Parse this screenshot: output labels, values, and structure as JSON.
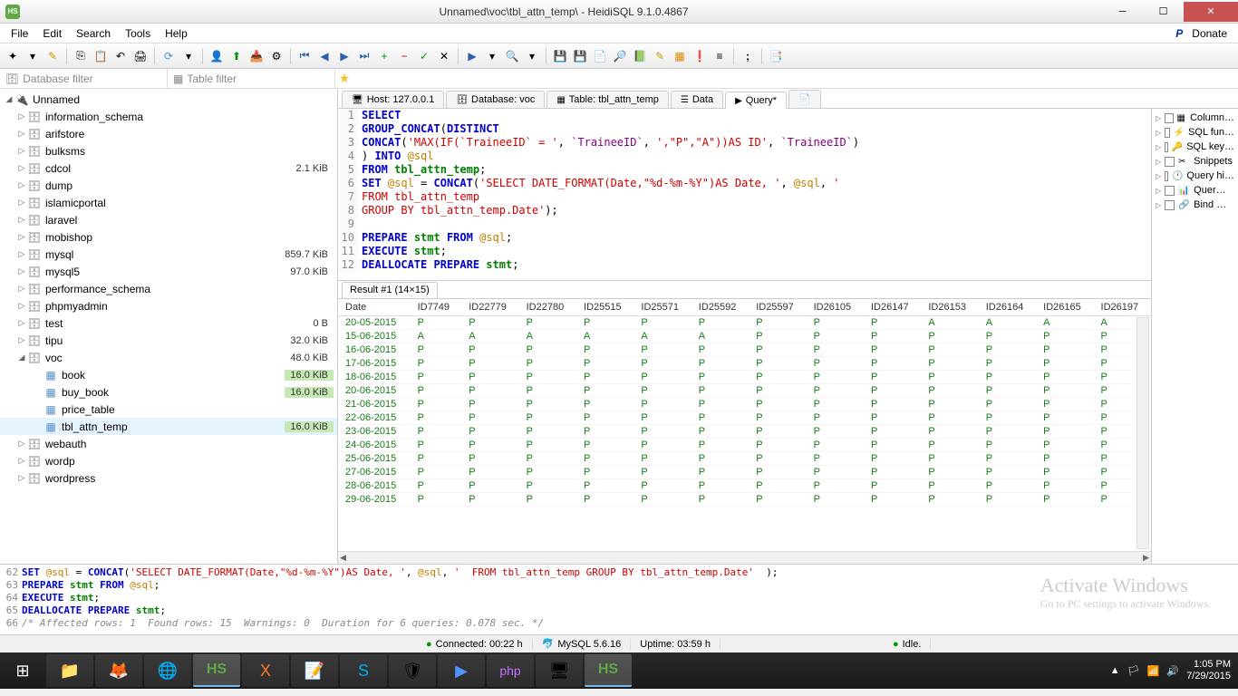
{
  "titlebar": {
    "appIcon": "HS",
    "title": "Unnamed\\voc\\tbl_attn_temp\\ - HeidiSQL 9.1.0.4867"
  },
  "menu": {
    "items": [
      "File",
      "Edit",
      "Search",
      "Tools",
      "Help"
    ],
    "donate": "Donate"
  },
  "filters": {
    "database": "Database filter",
    "table": "Table filter"
  },
  "tree": {
    "root": "Unnamed",
    "items": [
      {
        "label": "information_schema",
        "size": "",
        "indent": 1,
        "icon": "db"
      },
      {
        "label": "arifstore",
        "size": "",
        "indent": 1,
        "icon": "db"
      },
      {
        "label": "bulksms",
        "size": "",
        "indent": 1,
        "icon": "db"
      },
      {
        "label": "cdcol",
        "size": "2.1 KiB",
        "indent": 1,
        "icon": "db"
      },
      {
        "label": "dump",
        "size": "",
        "indent": 1,
        "icon": "db"
      },
      {
        "label": "islamicportal",
        "size": "",
        "indent": 1,
        "icon": "db"
      },
      {
        "label": "laravel",
        "size": "",
        "indent": 1,
        "icon": "db"
      },
      {
        "label": "mobishop",
        "size": "",
        "indent": 1,
        "icon": "db"
      },
      {
        "label": "mysql",
        "size": "859.7 KiB",
        "indent": 1,
        "icon": "db"
      },
      {
        "label": "mysql5",
        "size": "97.0 KiB",
        "indent": 1,
        "icon": "db"
      },
      {
        "label": "performance_schema",
        "size": "",
        "indent": 1,
        "icon": "db"
      },
      {
        "label": "phpmyadmin",
        "size": "",
        "indent": 1,
        "icon": "db"
      },
      {
        "label": "test",
        "size": "0 B",
        "indent": 1,
        "icon": "db"
      },
      {
        "label": "tipu",
        "size": "32.0 KiB",
        "indent": 1,
        "icon": "db"
      },
      {
        "label": "voc",
        "size": "48.0 KiB",
        "indent": 1,
        "icon": "db",
        "expanded": true
      },
      {
        "label": "book",
        "size": "16.0 KiB",
        "indent": 2,
        "icon": "tbl",
        "hl": true
      },
      {
        "label": "buy_book",
        "size": "16.0 KiB",
        "indent": 2,
        "icon": "tbl",
        "hl": true
      },
      {
        "label": "price_table",
        "size": "",
        "indent": 2,
        "icon": "tbl"
      },
      {
        "label": "tbl_attn_temp",
        "size": "16.0 KiB",
        "indent": 2,
        "icon": "tbl",
        "hl": true,
        "selected": true
      },
      {
        "label": "webauth",
        "size": "",
        "indent": 1,
        "icon": "db"
      },
      {
        "label": "wordp",
        "size": "",
        "indent": 1,
        "icon": "db"
      },
      {
        "label": "wordpress",
        "size": "",
        "indent": 1,
        "icon": "db"
      }
    ]
  },
  "tabs": {
    "items": [
      {
        "label": "Host: 127.0.0.1",
        "icon": "🖥"
      },
      {
        "label": "Database: voc",
        "icon": "🗄"
      },
      {
        "label": "Table: tbl_attn_temp",
        "icon": "▦"
      },
      {
        "label": "Data",
        "icon": "☰"
      },
      {
        "label": "Query*",
        "icon": "▶",
        "active": true
      }
    ]
  },
  "editor": {
    "lines": [
      {
        "n": "1",
        "html": "<span class='kw'>SELECT</span>"
      },
      {
        "n": "2",
        "html": "<span class='kw'>GROUP_CONCAT</span>(<span class='kw'>DISTINCT</span>"
      },
      {
        "n": "3",
        "html": "<span class='kw'>CONCAT</span>(<span class='str'>'MAX(IF(`TraineeID` = '</span>, <span class='id'>`TraineeID`</span>, <span class='str'>',\"P\",\"A\"))AS ID'</span>, <span class='id'>`TraineeID`</span>)"
      },
      {
        "n": "4",
        "html": ") <span class='kw'>INTO</span> <span class='var'>@sql</span>"
      },
      {
        "n": "5",
        "html": "<span class='kw'>FROM</span> <span class='kw2'>tbl_attn_temp</span>;"
      },
      {
        "n": "6",
        "html": "<span class='kw'>SET</span> <span class='var'>@sql</span> = <span class='kw'>CONCAT</span>(<span class='str'>'SELECT DATE_FORMAT(Date,\"%d-%m-%Y\")AS Date, '</span>, <span class='var'>@sql</span>, <span class='str'>'</span>"
      },
      {
        "n": "7",
        "html": "<span class='str'>FROM tbl_attn_temp</span>"
      },
      {
        "n": "8",
        "html": "<span class='str'>GROUP BY tbl_attn_temp.Date'</span>);"
      },
      {
        "n": "9",
        "html": ""
      },
      {
        "n": "10",
        "html": "<span class='kw'>PREPARE</span> <span class='kw2'>stmt</span> <span class='kw'>FROM</span> <span class='var'>@sql</span>;"
      },
      {
        "n": "11",
        "html": "<span class='kw'>EXECUTE</span> <span class='kw2'>stmt</span>;"
      },
      {
        "n": "12",
        "html": "<span class='kw'>DEALLOCATE</span> <span class='kw'>PREPARE</span> <span class='kw2'>stmt</span>;"
      }
    ]
  },
  "sidePanel": {
    "items": [
      "Column…",
      "SQL fun…",
      "SQL key…",
      "Snippets",
      "Query hi…",
      "Quer…",
      "Bind …"
    ]
  },
  "result": {
    "tabLabel": "Result #1 (14×15)",
    "headers": [
      "Date",
      "ID7749",
      "ID22779",
      "ID22780",
      "ID25515",
      "ID25571",
      "ID25592",
      "ID25597",
      "ID26105",
      "ID26147",
      "ID26153",
      "ID26164",
      "ID26165",
      "ID26197"
    ],
    "rows": [
      [
        "20-05-2015",
        "P",
        "P",
        "P",
        "P",
        "P",
        "P",
        "P",
        "P",
        "P",
        "A",
        "A",
        "A",
        "A"
      ],
      [
        "15-06-2015",
        "A",
        "A",
        "A",
        "A",
        "A",
        "A",
        "P",
        "P",
        "P",
        "P",
        "P",
        "P",
        "P"
      ],
      [
        "16-06-2015",
        "P",
        "P",
        "P",
        "P",
        "P",
        "P",
        "P",
        "P",
        "P",
        "P",
        "P",
        "P",
        "P"
      ],
      [
        "17-06-2015",
        "P",
        "P",
        "P",
        "P",
        "P",
        "P",
        "P",
        "P",
        "P",
        "P",
        "P",
        "P",
        "P"
      ],
      [
        "18-06-2015",
        "P",
        "P",
        "P",
        "P",
        "P",
        "P",
        "P",
        "P",
        "P",
        "P",
        "P",
        "P",
        "P"
      ],
      [
        "20-06-2015",
        "P",
        "P",
        "P",
        "P",
        "P",
        "P",
        "P",
        "P",
        "P",
        "P",
        "P",
        "P",
        "P"
      ],
      [
        "21-06-2015",
        "P",
        "P",
        "P",
        "P",
        "P",
        "P",
        "P",
        "P",
        "P",
        "P",
        "P",
        "P",
        "P"
      ],
      [
        "22-06-2015",
        "P",
        "P",
        "P",
        "P",
        "P",
        "P",
        "P",
        "P",
        "P",
        "P",
        "P",
        "P",
        "P"
      ],
      [
        "23-06-2015",
        "P",
        "P",
        "P",
        "P",
        "P",
        "P",
        "P",
        "P",
        "P",
        "P",
        "P",
        "P",
        "P"
      ],
      [
        "24-06-2015",
        "P",
        "P",
        "P",
        "P",
        "P",
        "P",
        "P",
        "P",
        "P",
        "P",
        "P",
        "P",
        "P"
      ],
      [
        "25-06-2015",
        "P",
        "P",
        "P",
        "P",
        "P",
        "P",
        "P",
        "P",
        "P",
        "P",
        "P",
        "P",
        "P"
      ],
      [
        "27-06-2015",
        "P",
        "P",
        "P",
        "P",
        "P",
        "P",
        "P",
        "P",
        "P",
        "P",
        "P",
        "P",
        "P"
      ],
      [
        "28-06-2015",
        "P",
        "P",
        "P",
        "P",
        "P",
        "P",
        "P",
        "P",
        "P",
        "P",
        "P",
        "P",
        "P"
      ],
      [
        "29-06-2015",
        "P",
        "P",
        "P",
        "P",
        "P",
        "P",
        "P",
        "P",
        "P",
        "P",
        "P",
        "P",
        "P"
      ]
    ]
  },
  "log": {
    "lines": [
      {
        "n": "62",
        "html": "<span class='kw'>SET</span> <span class='var'>@sql</span> = <span class='kw'>CONCAT</span>(<span class='str'>'SELECT DATE_FORMAT(Date,\"%d-%m-%Y\")AS Date, '</span>, <span class='var'>@sql</span>, <span class='str'>'  FROM tbl_attn_temp GROUP BY tbl_attn_temp.Date'</span>  );"
      },
      {
        "n": "63",
        "html": "<span class='kw'>PREPARE</span> <span class='kw2'>stmt</span> <span class='kw'>FROM</span> <span class='var'>@sql</span>;"
      },
      {
        "n": "64",
        "html": "<span class='kw'>EXECUTE</span> <span class='kw2'>stmt</span>;"
      },
      {
        "n": "65",
        "html": "<span class='kw'>DEALLOCATE</span> <span class='kw'>PREPARE</span> <span class='kw2'>stmt</span>;"
      },
      {
        "n": "66",
        "html": "<span class='cmt'>/* Affected rows: 1  Found rows: 15  Warnings: 0  Duration for 6 queries: 0.078 sec. */</span>"
      }
    ],
    "watermark1": "Activate Windows",
    "watermark2": "Go to PC settings to activate Windows."
  },
  "status": {
    "connected": "Connected: 00:22 h",
    "server": "MySQL 5.6.16",
    "uptime": "Uptime: 03:59 h",
    "idle": "Idle."
  },
  "taskbar": {
    "time": "1:05 PM",
    "date": "7/29/2015"
  }
}
